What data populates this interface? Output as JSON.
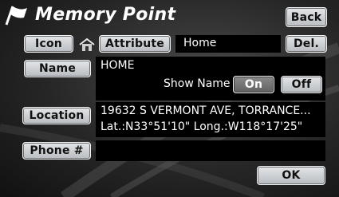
{
  "header": {
    "title": "Memory Point",
    "back_label": "Back"
  },
  "row_icon": {
    "icon_label": "Icon",
    "attribute_label": "Attribute",
    "attribute_value": "Home",
    "delete_label": "Del."
  },
  "row_name": {
    "name_label": "Name",
    "name_value": "HOME",
    "show_name_label": "Show Name",
    "on_label": "On",
    "off_label": "Off",
    "show_name_state": "On"
  },
  "row_location": {
    "location_label": "Location",
    "address": "19632 S VERMONT AVE, TORRANCE...",
    "coordinates": "Lat.:N33°51'10\" Long.:W118°17'25\""
  },
  "row_phone": {
    "phone_label": "Phone #",
    "phone_value": ""
  },
  "footer": {
    "ok_label": "OK"
  },
  "colors": {
    "button_face": "#d0d3d6",
    "button_active": "#707070",
    "panel_background": "#000000",
    "text": "#ffffff"
  },
  "icons": {
    "title_icon": "flag-icon",
    "attribute_icon": "home-icon"
  }
}
